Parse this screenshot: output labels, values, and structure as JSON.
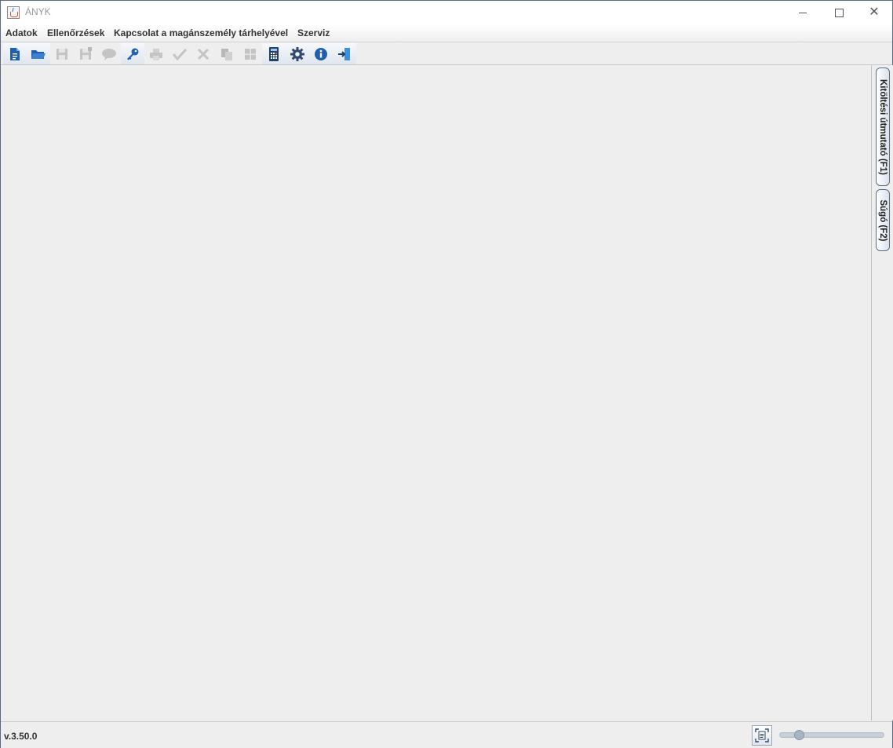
{
  "window": {
    "title": "ÁNYK"
  },
  "menu": [
    {
      "label": "Adatok"
    },
    {
      "label": "Ellenőrzések"
    },
    {
      "label": "Kapcsolat a magánszemély tárhelyével"
    },
    {
      "label": "Szerviz"
    }
  ],
  "toolbar": [
    {
      "icon": "new-document-icon",
      "enabled": true
    },
    {
      "icon": "open-folder-icon",
      "enabled": true
    },
    {
      "icon": "save-icon",
      "enabled": false
    },
    {
      "icon": "save-all-icon",
      "enabled": false
    },
    {
      "icon": "comment-icon",
      "enabled": false
    },
    {
      "icon": "key-icon",
      "enabled": true
    },
    {
      "icon": "print-icon",
      "enabled": false
    },
    {
      "icon": "check-icon",
      "enabled": false
    },
    {
      "icon": "delete-icon",
      "enabled": false
    },
    {
      "icon": "copy-icon",
      "enabled": false
    },
    {
      "icon": "grid-icon",
      "enabled": false
    },
    {
      "icon": "calculator-icon",
      "enabled": true
    },
    {
      "icon": "settings-gear-icon",
      "enabled": true
    },
    {
      "icon": "info-icon",
      "enabled": true
    },
    {
      "icon": "exit-icon",
      "enabled": true
    }
  ],
  "side_tabs": [
    {
      "label": "Kitöltési útmutató (F1)"
    },
    {
      "label": "Súgó (F2)"
    }
  ],
  "status": {
    "version": "v.3.50.0",
    "zoom_fraction": 0.16
  },
  "colors": {
    "accent_blue": "#1f5fae",
    "disabled_gray": "#c4c4c4",
    "background": "#eeeeee"
  }
}
